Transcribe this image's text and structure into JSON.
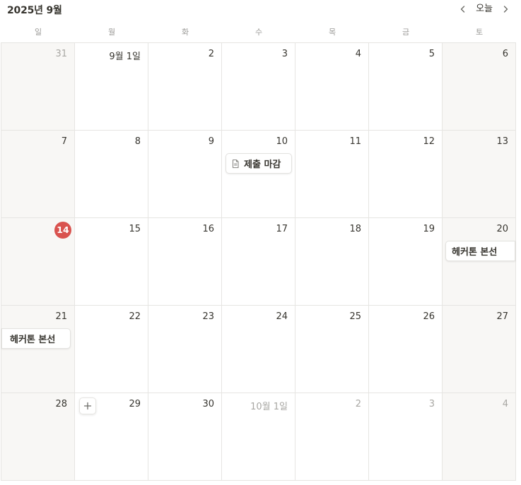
{
  "header": {
    "title": "2025년 9월",
    "today_label": "오늘",
    "prev_icon": "chevron-left-icon",
    "next_icon": "chevron-right-icon"
  },
  "weekdays": [
    "일",
    "월",
    "화",
    "수",
    "목",
    "금",
    "토"
  ],
  "weeks": [
    [
      {
        "label": "31",
        "muted": true
      },
      {
        "label": "9월 1일"
      },
      {
        "label": "2"
      },
      {
        "label": "3"
      },
      {
        "label": "4"
      },
      {
        "label": "5"
      },
      {
        "label": "6"
      }
    ],
    [
      {
        "label": "7"
      },
      {
        "label": "8"
      },
      {
        "label": "9"
      },
      {
        "label": "10"
      },
      {
        "label": "11"
      },
      {
        "label": "12"
      },
      {
        "label": "13"
      }
    ],
    [
      {
        "label": "14",
        "today": true
      },
      {
        "label": "15"
      },
      {
        "label": "16"
      },
      {
        "label": "17"
      },
      {
        "label": "18"
      },
      {
        "label": "19"
      },
      {
        "label": "20"
      }
    ],
    [
      {
        "label": "21"
      },
      {
        "label": "22"
      },
      {
        "label": "23"
      },
      {
        "label": "24"
      },
      {
        "label": "25"
      },
      {
        "label": "26"
      },
      {
        "label": "27"
      }
    ],
    [
      {
        "label": "28"
      },
      {
        "label": "29"
      },
      {
        "label": "30"
      },
      {
        "label": "10월 1일",
        "muted": true
      },
      {
        "label": "2",
        "muted": true
      },
      {
        "label": "3",
        "muted": true
      },
      {
        "label": "4",
        "muted": true
      }
    ]
  ],
  "events": {
    "deadline": {
      "title": "제출 마감",
      "icon": "document-icon"
    },
    "hackathon": {
      "title": "헤커톤 본선"
    }
  },
  "add_button": {
    "icon": "plus-icon"
  },
  "colors": {
    "today_badge": "#d9534f",
    "weekend_bg": "#f8f7f5",
    "border": "#e6e5e2"
  }
}
